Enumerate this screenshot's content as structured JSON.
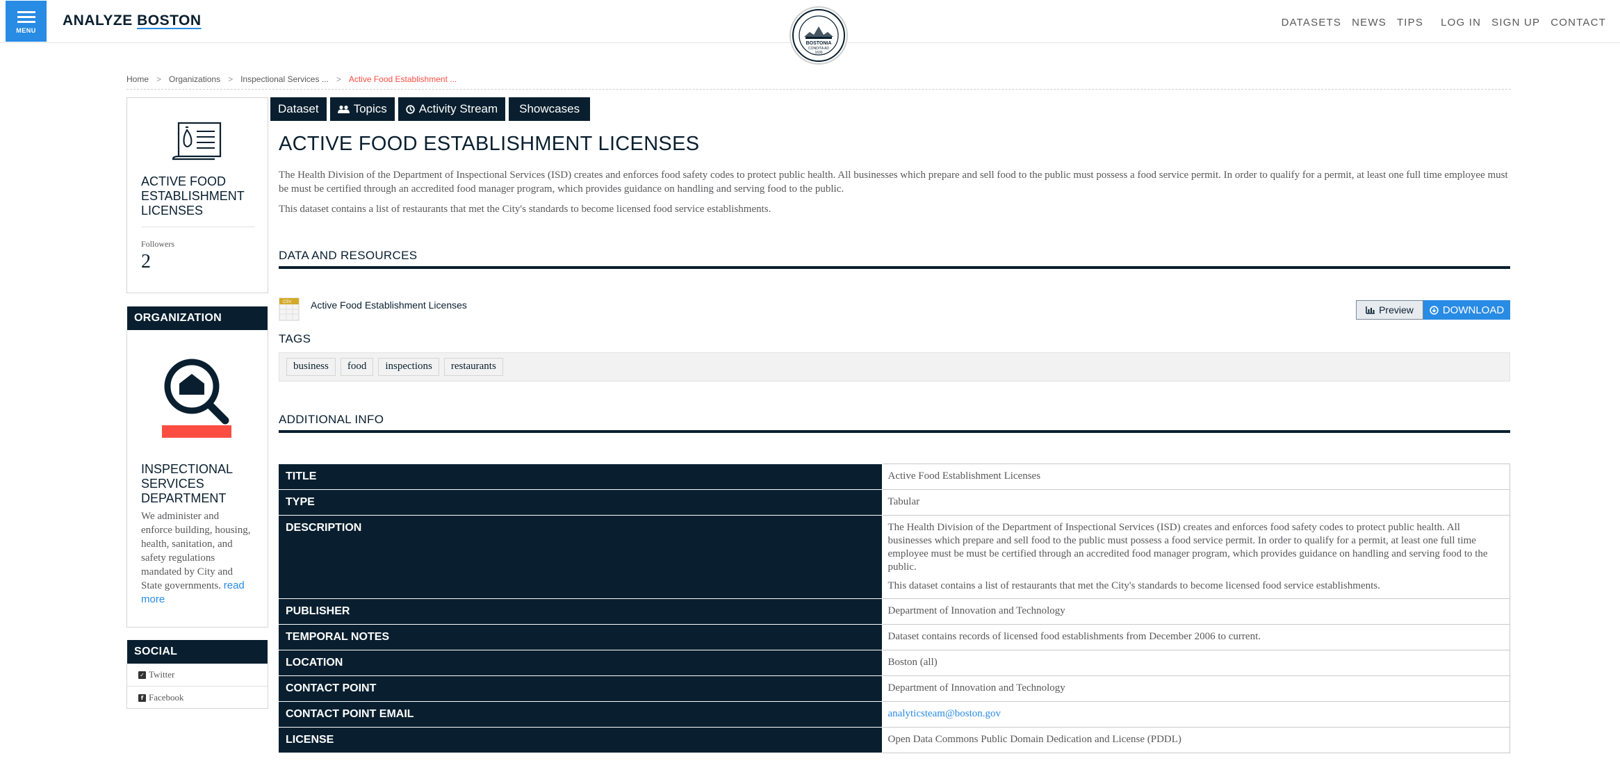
{
  "header": {
    "menu_label": "MENU",
    "brand_part1": "ANALYZE",
    "brand_part2": "BOSTON",
    "nav": [
      "DATASETS",
      "NEWS",
      "TIPS",
      "LOG IN",
      "SIGN UP",
      "CONTACT"
    ],
    "seal_text_top": "BOSTONIA",
    "seal_text_mid": "CONDITA AD",
    "seal_text_year": "1630"
  },
  "breadcrumb": {
    "items": [
      "Home",
      "Organizations",
      "Inspectional Services ...",
      "Active Food Establishment ..."
    ],
    "separator": ">"
  },
  "sidebar": {
    "dataset_title": "ACTIVE FOOD ESTABLISHMENT LICENSES",
    "followers_label": "Followers",
    "followers_value": "2",
    "organization_heading": "ORGANIZATION",
    "org_name": "INSPECTIONAL SERVICES DEPARTMENT",
    "org_description": "We administer and enforce building, housing, health, sanitation, and safety regulations mandated by City and State governments.",
    "org_read_more": "read more",
    "social_heading": "SOCIAL",
    "social_twitter": "Twitter",
    "social_facebook": "Facebook"
  },
  "tabs": [
    {
      "label": "Dataset",
      "icon": ""
    },
    {
      "label": "Topics",
      "icon": "users-icon"
    },
    {
      "label": "Activity Stream",
      "icon": "clock-icon"
    },
    {
      "label": "Showcases",
      "icon": ""
    }
  ],
  "main": {
    "title": "ACTIVE FOOD ESTABLISHMENT LICENSES",
    "description_1": "The Health Division of the Department of Inspectional Services (ISD) creates and enforces food safety codes to protect public health. All businesses which prepare and sell food to the public must possess a food service permit. In order to qualify for a permit, at least one full time employee must be must be certified through an accredited food manager program, which provides guidance on handling and serving food to the public.",
    "description_2": "This dataset contains a list of restaurants that met the City's standards to become licensed food service establishments.",
    "data_resources_heading": "DATA AND RESOURCES",
    "resource_name": "Active Food Establishment Licenses",
    "resource_format": "CSV",
    "preview_label": "Preview",
    "download_label": "DOWNLOAD",
    "tags_heading": "TAGS",
    "tags": [
      "business",
      "food",
      "inspections",
      "restaurants"
    ],
    "additional_info_heading": "ADDITIONAL INFO"
  },
  "info": {
    "title_label": "TITLE",
    "title_value": "Active Food Establishment Licenses",
    "type_label": "TYPE",
    "type_value": "Tabular",
    "description_label": "DESCRIPTION",
    "description_value_1": "The Health Division of the Department of Inspectional Services (ISD) creates and enforces food safety codes to protect public health. All businesses which prepare and sell food to the public must possess a food service permit. In order to qualify for a permit, at least one full time employee must be must be certified through an accredited food manager program, which provides guidance on handling and serving food to the public.",
    "description_value_2": "This dataset contains a list of restaurants that met the City's standards to become licensed food service establishments.",
    "publisher_label": "PUBLISHER",
    "publisher_value": "Department of Innovation and Technology",
    "temporal_label": "TEMPORAL NOTES",
    "temporal_value": "Dataset contains records of licensed food establishments from December 2006 to current.",
    "location_label": "LOCATION",
    "location_value": "Boston (all)",
    "contact_label": "CONTACT POINT",
    "contact_value": "Department of Innovation and Technology",
    "email_label": "CONTACT POINT EMAIL",
    "email_value": "analyticsteam@boston.gov",
    "license_label": "LICENSE",
    "license_value": "Open Data Commons Public Domain Dedication and License (PDDL)"
  },
  "colors": {
    "navy": "#091f2f",
    "accent_blue": "#288be4",
    "accent_red": "#fb4d42"
  }
}
